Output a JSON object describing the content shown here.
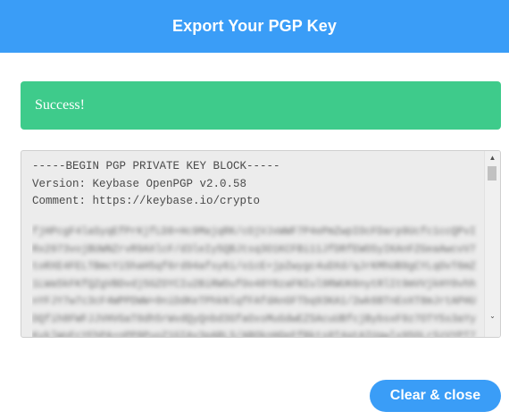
{
  "header": {
    "title": "Export Your PGP Key"
  },
  "alert": {
    "text": "Success!"
  },
  "key_box": {
    "lines": [
      "-----BEGIN PGP PRIVATE KEY BLOCK-----",
      "Version: Keybase OpenPGP v2.0.58",
      "Comment: https://keybase.io/crypto"
    ]
  },
  "footer": {
    "clear_close_label": "Clear & close"
  },
  "colors": {
    "header_bg": "#3a9df7",
    "success_bg": "#3ecb8b",
    "button_bg": "#3a9df7",
    "key_box_bg": "#ececec"
  },
  "icons": {
    "scroll_up": "triangle-up-icon",
    "scroll_down": "chevron-down-icon"
  }
}
